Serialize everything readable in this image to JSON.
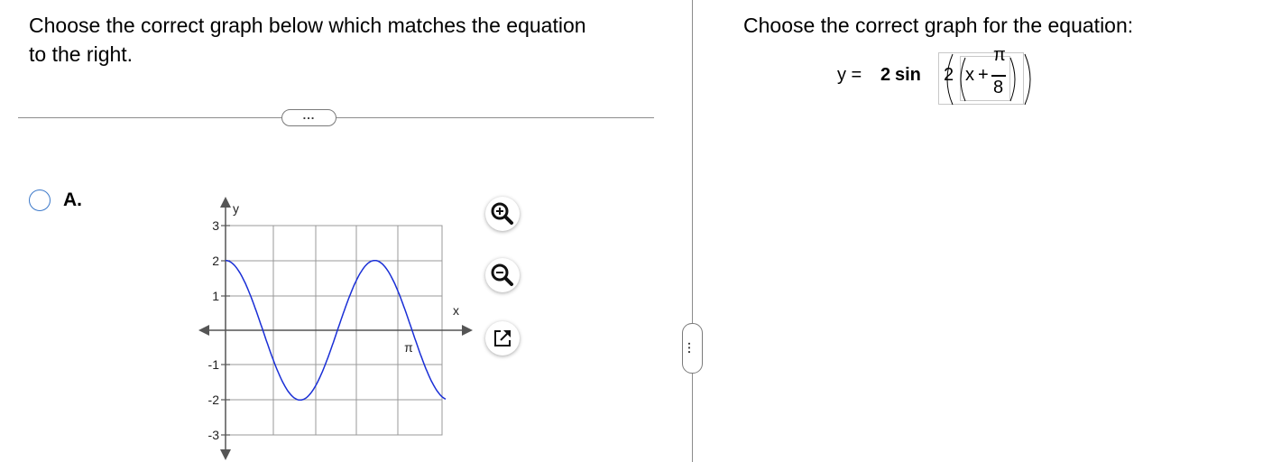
{
  "left": {
    "prompt": "Choose the correct graph below which matches the equation to the right.",
    "divider_more": "...",
    "option": {
      "label": "A.",
      "graph": {
        "x_axis_label": "x",
        "y_axis_label": "y",
        "x_tick_label": "π",
        "y_tick_labels": [
          "3",
          "2",
          "1",
          "-1",
          "-2",
          "-3"
        ],
        "y_range": [
          -3,
          3
        ],
        "x_range_in_pi": [
          -0.875,
          0.6
        ],
        "curve": "y = 2 sin(2(x + π/8))",
        "curve_color": "#1a2fd6",
        "grid_color": "#9a9a9a"
      }
    },
    "tools": [
      "zoom-in-icon",
      "zoom-out-icon",
      "expand-icon"
    ]
  },
  "splitter_more": "...",
  "right": {
    "title": "Choose the correct graph for the equation:",
    "equation": {
      "lhs": "y =",
      "coef": "2",
      "func": "sin",
      "inner_coef": "2",
      "var": "x",
      "plus": "+",
      "num": "π",
      "den": "8"
    }
  }
}
